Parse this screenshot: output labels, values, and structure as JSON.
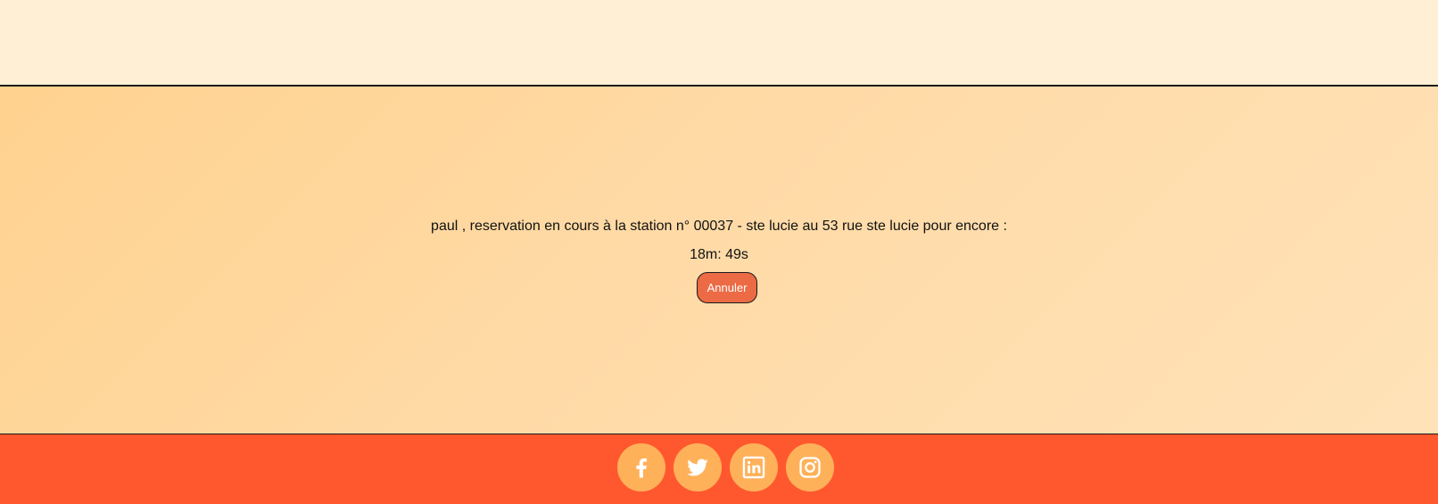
{
  "reservation": {
    "message": "paul , reservation en cours à la station n° 00037 - ste lucie au 53 rue ste lucie pour encore :",
    "timer": "18m: 49s",
    "cancel_label": "Annuler"
  },
  "footer": {
    "social_icons": [
      "facebook-icon",
      "twitter-icon",
      "linkedin-icon",
      "instagram-icon"
    ]
  },
  "colors": {
    "top_band": "#ffefd5",
    "main_background": "#ffd9a3",
    "cancel_button": "#ec6b45",
    "footer": "#ff582e",
    "social_button": "#ffb15a"
  }
}
